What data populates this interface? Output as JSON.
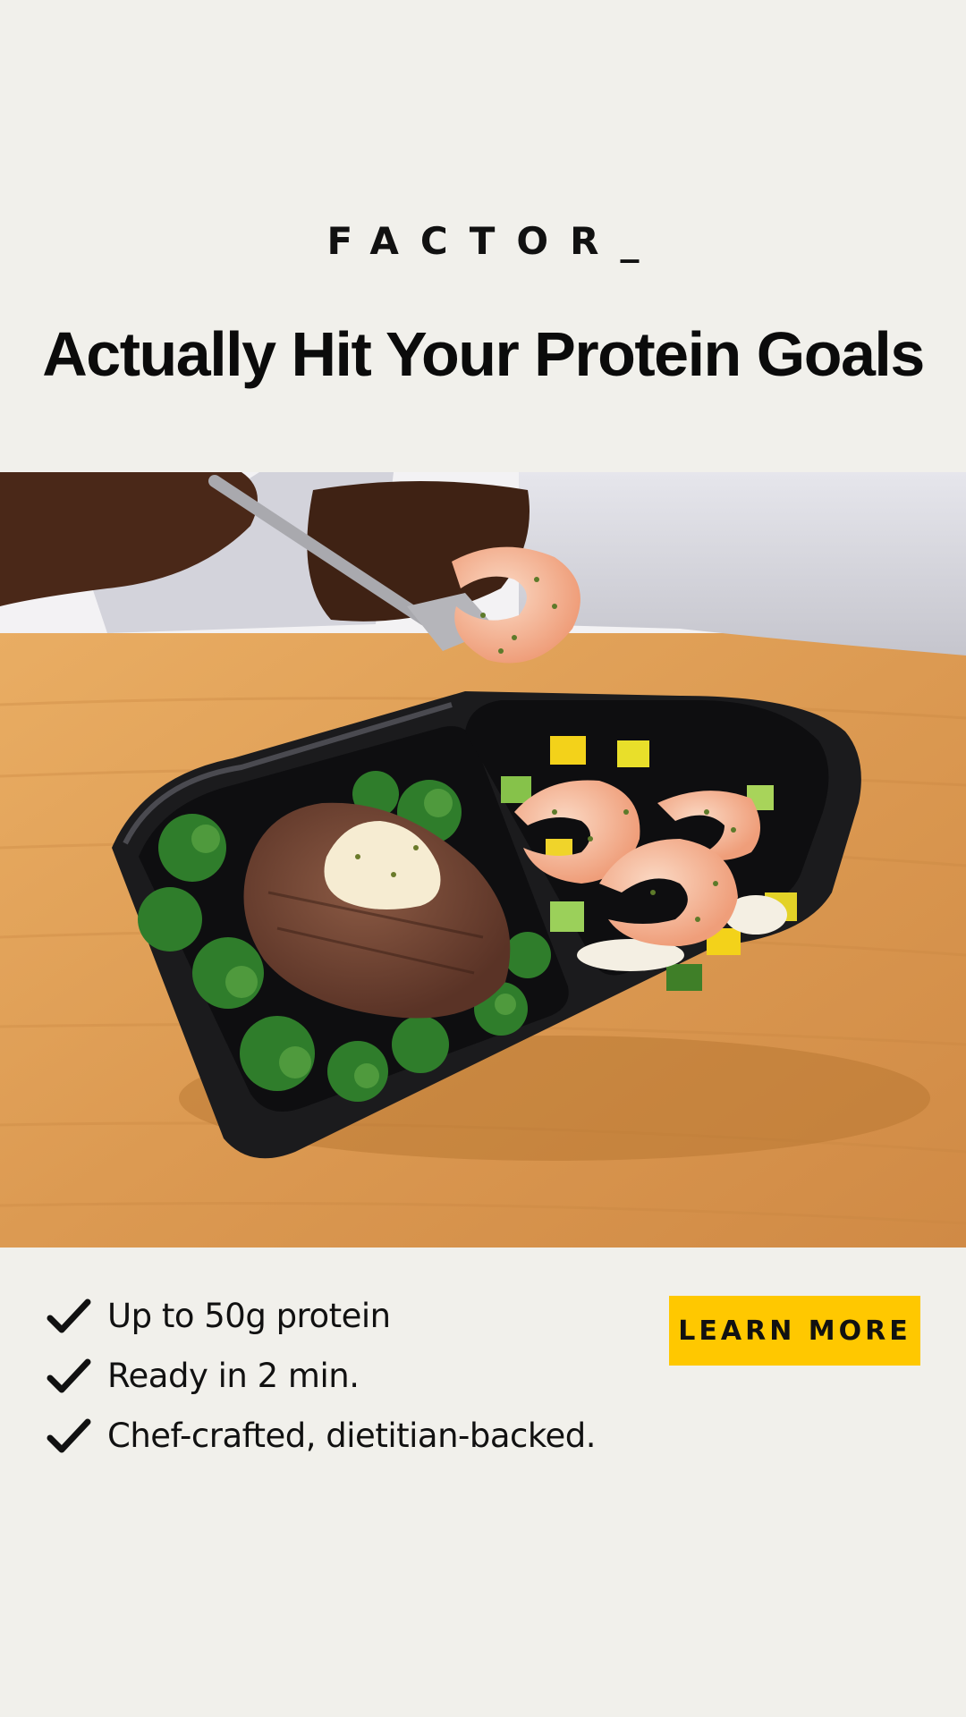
{
  "brand": {
    "logo_text": "FACTOR_"
  },
  "headline": "Actually Hit Your Protein Goals",
  "hero_image": {
    "description_icon": "meal-tray-photo",
    "colors": {
      "table": "#e3a05a",
      "tray": "#1d1d1f",
      "sleeve": "#d8d8de",
      "skin": "#4a2818"
    }
  },
  "features": [
    {
      "text": "Up to 50g protein",
      "icon": "check-icon"
    },
    {
      "text": "Ready in 2 min.",
      "icon": "check-icon"
    },
    {
      "text": "Chef-crafted, dietitian-backed.",
      "icon": "check-icon"
    }
  ],
  "cta": {
    "label": "LEARN MORE",
    "color": "#ffc800"
  },
  "background_color": "#f1f0eb"
}
